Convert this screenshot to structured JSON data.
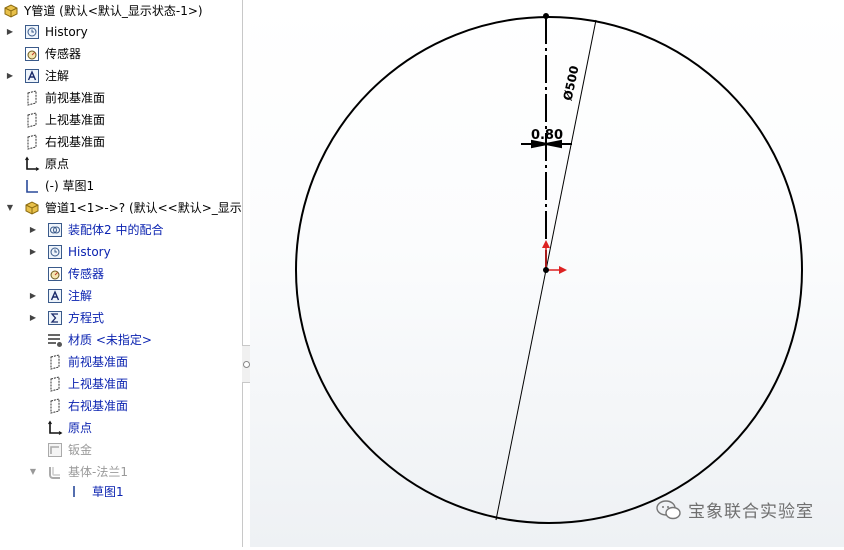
{
  "tree": {
    "root_title": "Y管道 (默认<默认_显示状态-1>)",
    "items": [
      {
        "label": "History"
      },
      {
        "label": "传感器"
      },
      {
        "label": "注解"
      },
      {
        "label": "前视基准面"
      },
      {
        "label": "上视基准面"
      },
      {
        "label": "右视基准面"
      },
      {
        "label": "原点"
      },
      {
        "label": "(-) 草图1"
      },
      {
        "label": "管道1<1>->? (默认<<默认>_显示状"
      },
      {
        "label": "装配体2 中的配合"
      },
      {
        "label": "History"
      },
      {
        "label": "传感器"
      },
      {
        "label": "注解"
      },
      {
        "label": "方程式"
      },
      {
        "label": "材质 <未指定>"
      },
      {
        "label": "前视基准面"
      },
      {
        "label": "上视基准面"
      },
      {
        "label": "右视基准面"
      },
      {
        "label": "原点"
      },
      {
        "label": "钣金"
      },
      {
        "label": "基体-法兰1"
      },
      {
        "label": "草图1"
      }
    ]
  },
  "viewport": {
    "diameter_label": "Ø500",
    "thickness_label": "0.80"
  },
  "watermark": "宝象联合实验室"
}
